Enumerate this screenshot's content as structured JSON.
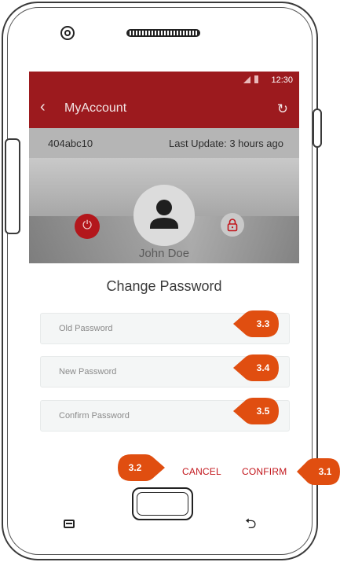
{
  "status_bar": {
    "time": "12:30"
  },
  "app_bar": {
    "title": "MyAccount"
  },
  "info_bar": {
    "device_id": "404abc10",
    "last_update": "Last Update: 3 hours ago"
  },
  "profile": {
    "name": "John Doe"
  },
  "dialog": {
    "title": "Change Password",
    "old_password_placeholder": "Old Password",
    "new_password_placeholder": "New Password",
    "confirm_password_placeholder": "Confirm Password",
    "cancel_label": "CANCEL",
    "confirm_label": "CONFIRM"
  },
  "callouts": {
    "c31": "3.1",
    "c32": "3.2",
    "c33": "3.3",
    "c34": "3.4",
    "c35": "3.5"
  },
  "colors": {
    "brand_red": "#9c1a1e",
    "action_red": "#c2151b",
    "callout_orange": "#e04e10"
  },
  "icons": [
    "camera-icon",
    "speaker-grille-icon",
    "back-arrow-icon",
    "refresh-icon",
    "person-icon",
    "power-icon",
    "lock-icon",
    "menu-key-icon",
    "home-key-icon",
    "back-key-icon"
  ]
}
